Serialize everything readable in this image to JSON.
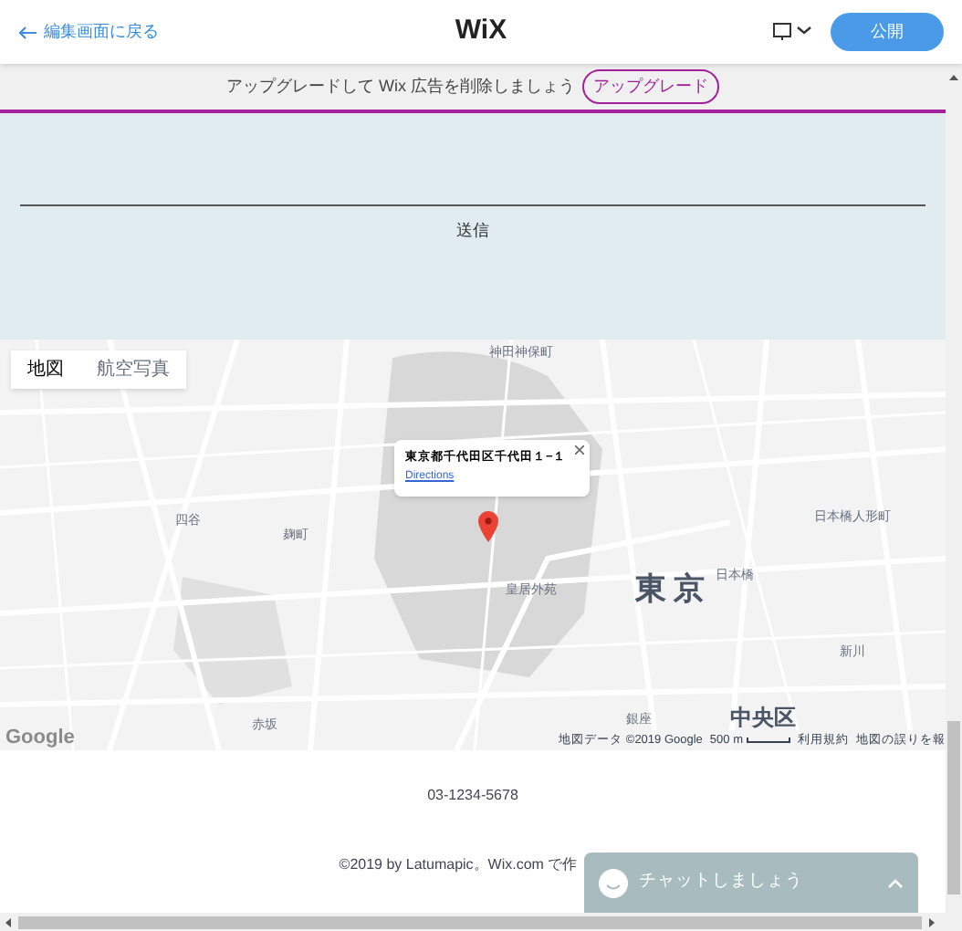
{
  "header": {
    "back_link": "編集画面に戻る",
    "logo": "WiX",
    "publish_button": "公開"
  },
  "upgrade_banner": {
    "text": "アップグレードして Wix 広告を削除しましょう",
    "button": "アップグレード"
  },
  "form": {
    "submit_label": "送信"
  },
  "map": {
    "map_types": [
      {
        "label": "地図",
        "selected": true
      },
      {
        "label": "航空写真",
        "selected": false
      }
    ],
    "popup": {
      "address": "東京都千代田区千代田１−１",
      "link": "Directions"
    },
    "labels": [
      {
        "text": "神田神保町",
        "kind": "place"
      },
      {
        "text": "四谷",
        "kind": "place"
      },
      {
        "text": "麹町",
        "kind": "place"
      },
      {
        "text": "皇居外苑",
        "kind": "place"
      },
      {
        "text": "東京",
        "kind": "city"
      },
      {
        "text": "日本橋",
        "kind": "place"
      },
      {
        "text": "日本橋人形町",
        "kind": "place"
      },
      {
        "text": "新川",
        "kind": "place"
      },
      {
        "text": "赤坂",
        "kind": "place"
      },
      {
        "text": "銀座",
        "kind": "place"
      },
      {
        "text": "中央区",
        "kind": "district"
      }
    ],
    "provider": "Google",
    "attribution": "地図データ ©2019 Google",
    "scale": "500 m",
    "terms": "利用規約",
    "report": "地図の誤りを報"
  },
  "footer": {
    "phone": "03-1234-5678",
    "copyright": "©2019 by Latumapic。Wix.com で作"
  },
  "chat": {
    "label": "チャットしましょう"
  }
}
